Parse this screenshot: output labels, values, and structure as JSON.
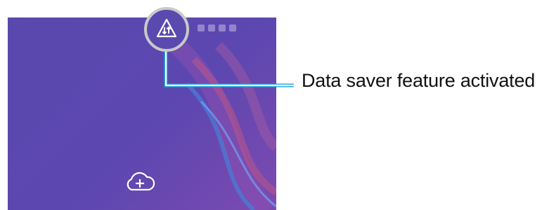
{
  "screen": {
    "background_color": "#5a48ad",
    "icons": [
      "data-saver-icon",
      "cloud-add-icon"
    ]
  },
  "callout": {
    "label": "Data saver feature activated",
    "line_color": "#1aa0d8",
    "ring_color": "#c9c9c9"
  },
  "status_bar": {
    "icons": [
      "sim-icon",
      "signal-icon",
      "battery-icon",
      "time-icon"
    ]
  }
}
